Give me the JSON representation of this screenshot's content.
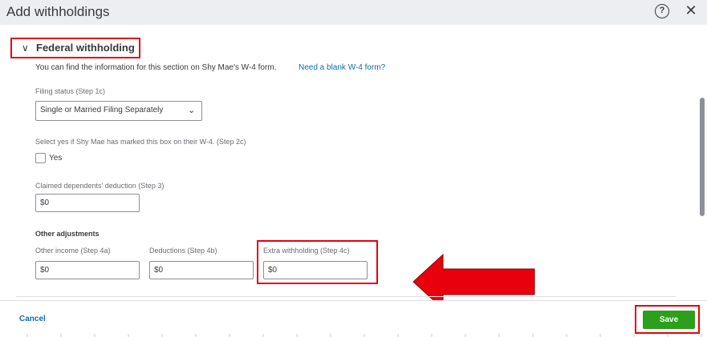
{
  "dialog": {
    "title": "Add withholdings",
    "help_icon": "?",
    "close_icon": "✕"
  },
  "section": {
    "chevron": "∨",
    "title": "Federal withholding",
    "info_text": "You can find the information for this section on Shy Mae's W-4 form.",
    "info_link": "Need a blank W-4 form?"
  },
  "filing_status": {
    "label": "Filing status (Step 1c)",
    "value": "Single or Married Filing Separately",
    "arrow": "⌄"
  },
  "step2c": {
    "label": "Select yes if Shy Mae has marked this box on their W-4. (Step 2c)",
    "checkbox_label": "Yes"
  },
  "dependents": {
    "label": "Claimed dependents' deduction (Step 3)",
    "value": "$0"
  },
  "other_adjustments": {
    "heading": "Other adjustments",
    "other_income_label": "Other income (Step 4a)",
    "other_income_value": "$0",
    "deductions_label": "Deductions (Step 4b)",
    "deductions_value": "$0",
    "extra_label": "Extra withholding (Step 4c)",
    "extra_value": "$0"
  },
  "footer": {
    "cancel_label": "Cancel",
    "save_label": "Save"
  },
  "colors": {
    "accent_green": "#2ca01c",
    "link_blue": "#0d6cb0",
    "annotation_red": "#e8000d"
  }
}
